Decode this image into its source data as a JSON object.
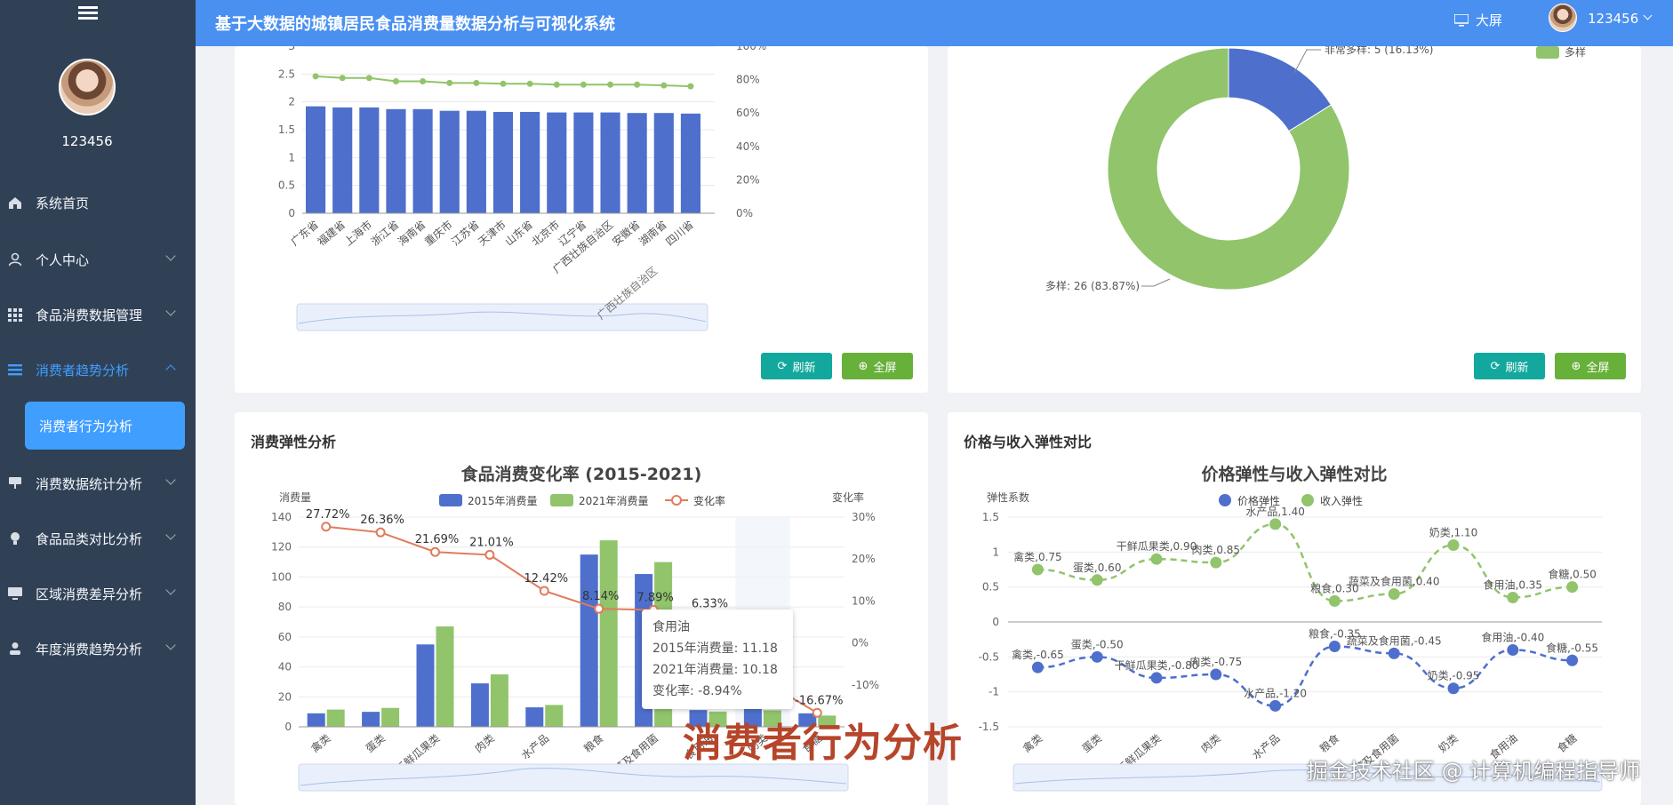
{
  "app": {
    "title": "基于大数据的城镇居民食品消费量数据分析与可视化系统",
    "screen_label": "大屏",
    "user": "123456",
    "accent": "#409eff",
    "sidebar_bg": "#304156",
    "header_bg": "#4a90f0"
  },
  "sidebar": {
    "username": "123456",
    "items": [
      {
        "label": "系统首页",
        "icon": "home-icon"
      },
      {
        "label": "个人中心",
        "icon": "user-icon"
      },
      {
        "label": "食品消费数据管理",
        "icon": "grid-icon"
      },
      {
        "label": "消费者趋势分析",
        "icon": "list-icon"
      },
      {
        "label": "消费数据统计分析",
        "icon": "chart-icon"
      },
      {
        "label": "食品品类对比分析",
        "icon": "bulb-icon"
      },
      {
        "label": "区域消费差异分析",
        "icon": "monitor-icon"
      },
      {
        "label": "年度消费趋势分析",
        "icon": "person-icon"
      }
    ],
    "active_sub": "消费者行为分析"
  },
  "buttons": {
    "refresh": "刷新",
    "fullscreen": "全屏"
  },
  "panels": {
    "elasticity_title": "消费弹性分析",
    "compare_title": "价格与收入弹性对比"
  },
  "overlay": {
    "watermark": "消费者行为分析",
    "credit": "掘金技术社区 @ 计算机编程指导师"
  },
  "chart_data": [
    {
      "type": "bar",
      "categories": [
        "广东省",
        "福建省",
        "上海市",
        "浙江省",
        "海南省",
        "重庆市",
        "江苏省",
        "天津市",
        "山东省",
        "北京市",
        "辽宁省",
        "广西壮族自治区",
        "安徽省",
        "湖南省",
        "四川省"
      ],
      "series": [
        {
          "values": [
            1.92,
            1.9,
            1.9,
            1.87,
            1.87,
            1.84,
            1.84,
            1.82,
            1.82,
            1.81,
            1.81,
            1.81,
            1.8,
            1.8,
            1.79
          ]
        },
        {
          "type": "line",
          "axis": "right",
          "values": [
            82,
            81,
            81,
            79,
            79,
            78,
            78,
            77.5,
            77.5,
            77,
            77,
            77,
            77,
            76.5,
            76
          ]
        }
      ],
      "ylim": [
        0,
        3
      ],
      "yticks": [
        "0",
        "0.5",
        "1",
        "1.5",
        "2",
        "2.5",
        "3"
      ],
      "y2ticks": [
        "0%",
        "20%",
        "40%",
        "60%",
        "80%",
        "100%"
      ],
      "colors": {
        "bar": "#4e6fcc",
        "line": "#91c46b"
      },
      "slider_label": "广西壮族自治区"
    },
    {
      "type": "pie",
      "labels": [
        "非常多样: 5 (16.13%)",
        "多样: 26 (83.87%)"
      ],
      "values": [
        5,
        26
      ],
      "legend": [
        "多样"
      ],
      "colors": [
        "#4e6fcc",
        "#91c46b"
      ]
    },
    {
      "type": "bar",
      "title": "食品消费变化率 (2015-2021)",
      "ylabel": "消费量",
      "y2label": "变化率",
      "categories": [
        "禽类",
        "蛋类",
        "干鲜瓜果类",
        "肉类",
        "水产品",
        "粮食",
        "蔬菜及食用菌",
        "食用油",
        "奶类",
        "食糖"
      ],
      "series": [
        {
          "name": "2015年消费量",
          "values": [
            9,
            10,
            55,
            29,
            13,
            115,
            102,
            11.18,
            12,
            9
          ]
        },
        {
          "name": "2021年消费量",
          "values": [
            11.5,
            12.6,
            67,
            35,
            14.6,
            124.5,
            110,
            10.18,
            11,
            7.5
          ]
        },
        {
          "name": "变化率",
          "type": "line",
          "values": [
            27.72,
            26.36,
            21.69,
            21.01,
            12.42,
            8.14,
            7.89,
            6.33,
            -8.94,
            -16.67
          ]
        }
      ],
      "point_labels": [
        "27.72%",
        "26.36%",
        "21.69%",
        "21.01%",
        "12.42%",
        "8.14%",
        "7.89%",
        "6.33%",
        "",
        "-16.67%"
      ],
      "ylim": [
        0,
        140
      ],
      "y2lim": [
        -20,
        30
      ],
      "yticks": [
        "0",
        "20",
        "40",
        "60",
        "80",
        "100",
        "120",
        "140"
      ],
      "y2ticks": [
        "-10%",
        "0%",
        "10%",
        "20%",
        "30%"
      ],
      "colors": {
        "bar1": "#4e6fcc",
        "bar2": "#91c46b",
        "line": "#e07b5c"
      },
      "tooltip": {
        "title": "食用油",
        "lines": [
          "2015年消费量: 11.18",
          "2021年消费量: 10.18",
          "变化率: -8.94%"
        ]
      }
    },
    {
      "type": "line",
      "title": "价格弹性与收入弹性对比",
      "ylabel": "弹性系数",
      "categories": [
        "禽类",
        "蛋类",
        "干鲜瓜果类",
        "肉类",
        "水产品",
        "粮食",
        "蔬菜及食用菌",
        "奶类",
        "食用油",
        "食糖"
      ],
      "series": [
        {
          "name": "价格弹性",
          "values": [
            -0.65,
            -0.5,
            -0.8,
            -0.75,
            -1.2,
            -0.35,
            -0.45,
            -0.95,
            -0.4,
            -0.55
          ]
        },
        {
          "name": "收入弹性",
          "values": [
            0.75,
            0.6,
            0.9,
            0.85,
            1.4,
            0.3,
            0.4,
            1.1,
            0.35,
            0.5
          ]
        }
      ],
      "point_labels_price": [
        "禽类,-0.65",
        "蛋类,-0.50",
        "干鲜瓜果类,-0.80",
        "肉类,-0.75",
        "水产品,-1.20",
        "粮食,-0.35",
        "蔬菜及食用菌,-0.45",
        "奶类,-0.95",
        "食用油,-0.40",
        "食糖,-0.55"
      ],
      "point_labels_income": [
        "禽类,0.75",
        "蛋类,0.60",
        "干鲜瓜果类,0.90",
        "肉类,0.85",
        "水产品,1.40",
        "粮食,0.30",
        "蔬菜及食用菌,0.40",
        "奶类,1.10",
        "食用油,0.35",
        "食糖,0.50"
      ],
      "ylim": [
        -1.5,
        1.5
      ],
      "yticks": [
        "-1.5",
        "-1",
        "-0.5",
        "0",
        "0.5",
        "1",
        "1.5"
      ],
      "colors": {
        "price": "#4e6fcc",
        "income": "#91c46b"
      }
    }
  ]
}
